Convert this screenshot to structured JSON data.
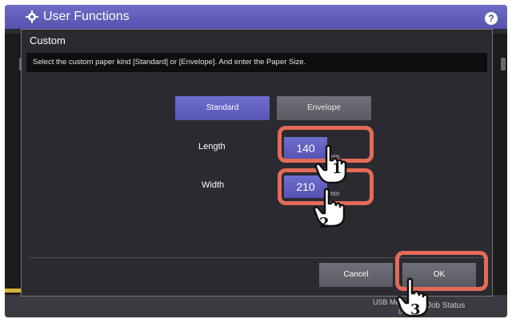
{
  "app": {
    "title": "User Functions",
    "help_label": "?"
  },
  "dialog": {
    "title": "Custom",
    "instruction": "Select the custom paper kind [Standard] or [Envelope]. And enter the Paper Size.",
    "kind_options": [
      {
        "label": "Standard",
        "selected": true
      },
      {
        "label": "Envelope",
        "selected": false
      }
    ],
    "fields": {
      "length": {
        "label": "Length",
        "value": "140",
        "unit": "mm"
      },
      "width": {
        "label": "Width",
        "value": "210",
        "unit": "mm"
      }
    },
    "buttons": {
      "cancel": "Cancel",
      "ok": "OK"
    }
  },
  "status_bar": {
    "usb_label": "USB Me",
    "usb_value": "0",
    "job_status_label": "Job Status"
  },
  "steps": [
    "1",
    "2",
    "3"
  ],
  "colors": {
    "accent": "#6f6ed0",
    "callout": "#e36b57",
    "header": "#5553ad",
    "warning": "#d7b533"
  },
  "icons": {
    "header_icon": "gear-icon",
    "pointer_icon": "hand-pointer-icon"
  }
}
